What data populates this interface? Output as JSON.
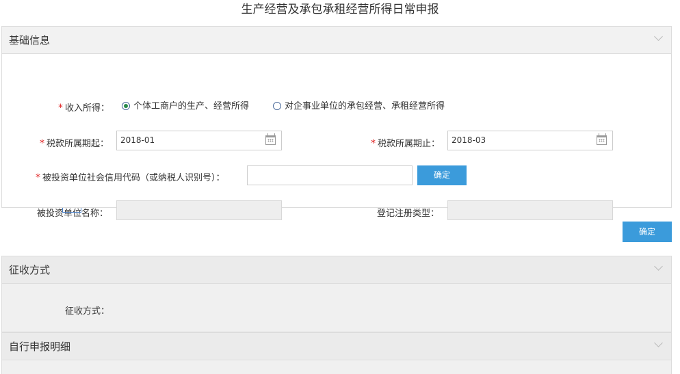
{
  "page": {
    "title": "生产经营及承包承租经营所得日常申报"
  },
  "basic_info": {
    "header": "基础信息",
    "income_label": "收入所得：",
    "income_options": [
      {
        "label": "个体工商户的生产、经营所得",
        "checked": true
      },
      {
        "label": "对企事业单位的承包经营、承租经营所得",
        "checked": false
      }
    ],
    "period_start_label": "税款所属期起：",
    "period_start_value": "2018-01",
    "period_end_label": "税款所属期止：",
    "period_end_value": "2018-03",
    "credit_code_label": "被投资单位社会信用代码（或纳税人识别号）：",
    "credit_code_value": "",
    "confirm_label": "确定",
    "unit_name_label": "被投资单位名称：",
    "unit_name_value": "",
    "reg_type_label": "登记注册类型：",
    "reg_type_value": ""
  },
  "main_confirm_label": "确定",
  "collection": {
    "header": "征收方式",
    "method_label": "征收方式："
  },
  "self_declare": {
    "header": "自行申报明细"
  },
  "colors": {
    "accent": "#3b9bdb",
    "required": "#e02020",
    "header_bg": "#f2f2f2"
  }
}
